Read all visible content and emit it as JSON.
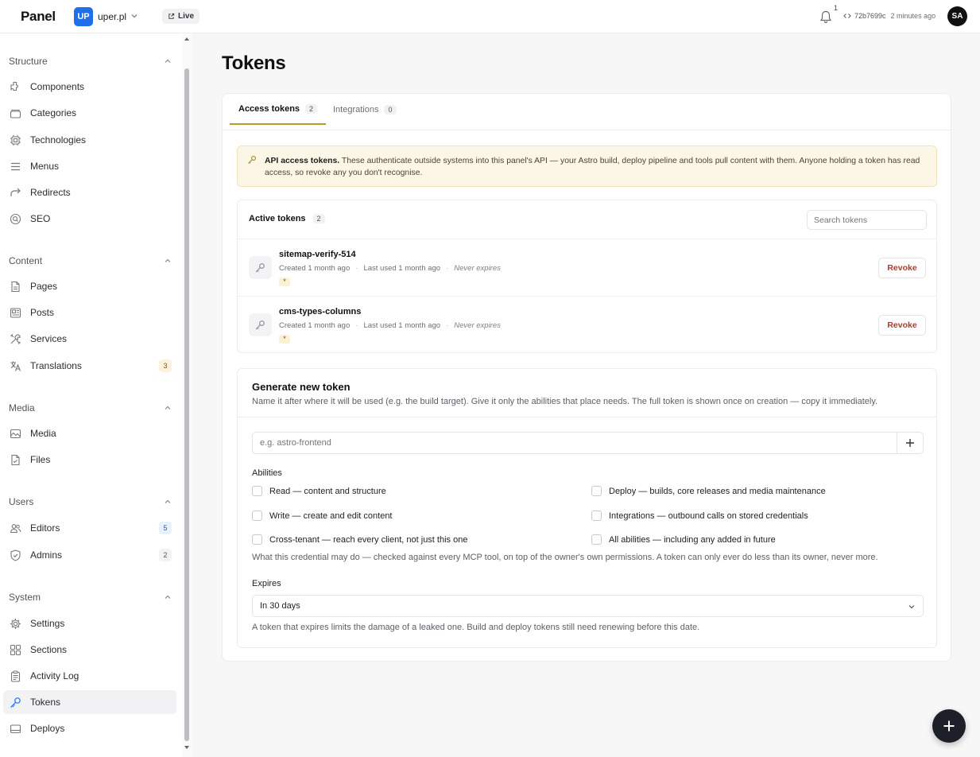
{
  "topbar": {
    "brand": "Panel",
    "site_badge": "UP",
    "site_name": "uper.pl",
    "live_label": "Live",
    "notifications_count": "1",
    "commit_hash": "72b7699c",
    "commit_time": "2 minutes ago",
    "avatar_initials": "SA"
  },
  "sidebar": {
    "structure": {
      "title": "Structure",
      "items": [
        {
          "label": "Components",
          "icon": "components-icon"
        },
        {
          "label": "Categories",
          "icon": "categories-icon"
        },
        {
          "label": "Technologies",
          "icon": "technologies-icon"
        },
        {
          "label": "Menus",
          "icon": "menu-icon"
        },
        {
          "label": "Redirects",
          "icon": "redirect-icon"
        },
        {
          "label": "SEO",
          "icon": "seo-icon"
        }
      ]
    },
    "content": {
      "title": "Content",
      "items": [
        {
          "label": "Pages",
          "icon": "page-icon"
        },
        {
          "label": "Posts",
          "icon": "posts-icon"
        },
        {
          "label": "Services",
          "icon": "services-icon"
        },
        {
          "label": "Translations",
          "icon": "translate-icon",
          "count": "3"
        }
      ]
    },
    "media": {
      "title": "Media",
      "items": [
        {
          "label": "Media",
          "icon": "image-icon"
        },
        {
          "label": "Files",
          "icon": "file-icon"
        }
      ]
    },
    "users": {
      "title": "Users",
      "items": [
        {
          "label": "Editors",
          "icon": "users-icon",
          "count": "5"
        },
        {
          "label": "Admins",
          "icon": "shield-icon",
          "count": "2"
        }
      ]
    },
    "system": {
      "title": "System",
      "items": [
        {
          "label": "Settings",
          "icon": "gear-icon"
        },
        {
          "label": "Sections",
          "icon": "sections-icon"
        },
        {
          "label": "Activity Log",
          "icon": "clipboard-icon"
        },
        {
          "label": "Tokens",
          "icon": "key-icon"
        },
        {
          "label": "Deploys",
          "icon": "deploy-icon"
        }
      ]
    }
  },
  "main": {
    "title": "Tokens",
    "tabs": [
      {
        "label": "Access tokens",
        "count": "2"
      },
      {
        "label": "Integrations",
        "count": "0"
      }
    ],
    "notice": {
      "bold": "API access tokens.",
      "text": " These authenticate outside systems into this panel's API — your Astro build, deploy pipeline and tools pull content with them. Anyone holding a token has read access, so revoke any you don't recognise."
    },
    "active_tokens": {
      "title": "Active tokens",
      "count": "2",
      "search_placeholder": "Search tokens",
      "rows": [
        {
          "name": "sitemap-verify-514",
          "created": "Created 1 month ago",
          "last_used": "Last used 1 month ago",
          "expires": "Never expires",
          "scope": "*",
          "action": "Revoke"
        },
        {
          "name": "cms-types-columns",
          "created": "Created 1 month ago",
          "last_used": "Last used 1 month ago",
          "expires": "Never expires",
          "scope": "*",
          "action": "Revoke"
        }
      ]
    },
    "generate": {
      "title": "Generate new token",
      "description": "Name it after where it will be used (e.g. the build target). Give it only the abilities that place needs. The full token is shown once on creation — copy it immediately.",
      "name_placeholder": "e.g. astro-frontend",
      "abilities_label": "Abilities",
      "abilities": [
        {
          "label": "Read — content and structure",
          "checked": false
        },
        {
          "label": "Deploy — builds, core releases and media maintenance",
          "checked": false
        },
        {
          "label": "Write — create and edit content",
          "checked": false
        },
        {
          "label": "Integrations — outbound calls on stored credentials",
          "checked": false
        },
        {
          "label": "Cross-tenant — reach every client, not just this one",
          "checked": false
        },
        {
          "label": "All abilities — including any added in future",
          "checked": false
        }
      ],
      "abilities_help": "What this credential may do — checked against every MCP tool, on top of the owner's own permissions. A token can only ever do less than its owner, never more.",
      "expires_label": "Expires",
      "expires_value": "In 30 days",
      "expires_help": "A token that expires limits the damage of a leaked one. Build and deploy tokens still need renewing before this date."
    }
  },
  "colors": {
    "accent_tab": "#b99a2d",
    "notice_bg": "#fcf6e7",
    "revoke_text": "#b23a2a",
    "site_badge": "#1f6feb"
  }
}
